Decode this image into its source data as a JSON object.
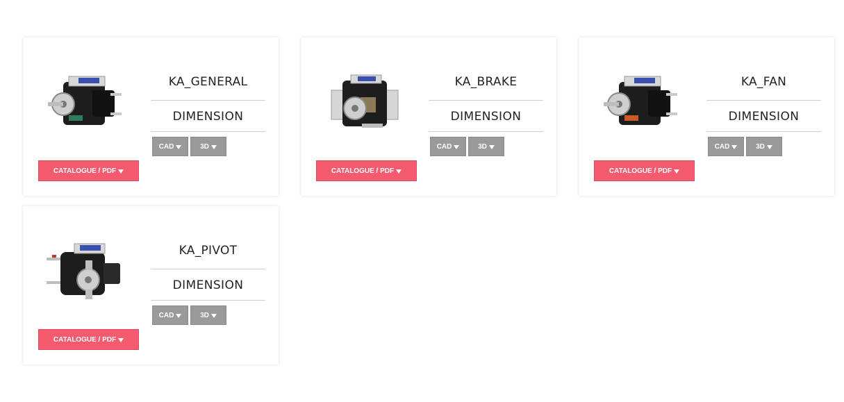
{
  "products": [
    {
      "name": "KA_GENERAL",
      "dimension_label": "DIMENSION",
      "cad_label": "CAD",
      "threed_label": "3D",
      "catalogue_label": "CATALOGUE / PDF",
      "image_icon": "shaded-pole-motor-general"
    },
    {
      "name": "KA_BRAKE",
      "dimension_label": "DIMENSION",
      "cad_label": "CAD",
      "threed_label": "3D",
      "catalogue_label": "CATALOGUE / PDF",
      "image_icon": "shaded-pole-motor-brake"
    },
    {
      "name": "KA_FAN",
      "dimension_label": "DIMENSION",
      "cad_label": "CAD",
      "threed_label": "3D",
      "catalogue_label": "CATALOGUE / PDF",
      "image_icon": "shaded-pole-motor-fan"
    },
    {
      "name": "KA_PIVOT",
      "dimension_label": "DIMENSION",
      "cad_label": "CAD",
      "threed_label": "3D",
      "catalogue_label": "CATALOGUE / PDF",
      "image_icon": "shaded-pole-motor-pivot"
    }
  ],
  "colors": {
    "catalogue_button": "#f45b6e",
    "file_button": "#9a9a9a",
    "divider": "#cfcfcf",
    "text": "#222222"
  }
}
